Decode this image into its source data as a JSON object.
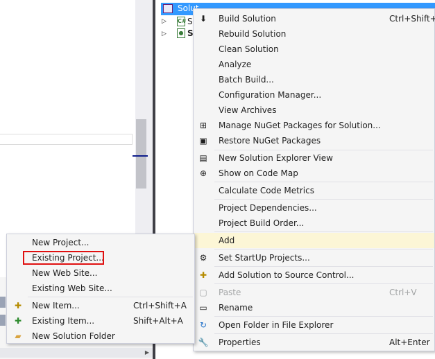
{
  "solution_explorer": {
    "solution_label": "Solution 'SolarCheck'",
    "project_1_icon": "C#",
    "project_1_label": "S",
    "project_2_label": "S"
  },
  "context_menu": {
    "items": [
      {
        "label": "Build Solution",
        "shortcut": "Ctrl+Shift+B",
        "icon": "build-icon"
      },
      {
        "label": "Rebuild Solution",
        "shortcut": "",
        "icon": ""
      },
      {
        "label": "Clean Solution",
        "shortcut": "",
        "icon": ""
      },
      {
        "label": "Analyze",
        "shortcut": "",
        "icon": ""
      },
      {
        "label": "Batch Build...",
        "shortcut": "",
        "icon": ""
      },
      {
        "label": "Configuration Manager...",
        "shortcut": "",
        "icon": ""
      },
      {
        "label": "View Archives",
        "shortcut": "",
        "icon": ""
      },
      {
        "label": "Manage NuGet Packages for Solution...",
        "shortcut": "",
        "icon": "nuget-icon"
      },
      {
        "label": "Restore NuGet Packages",
        "shortcut": "",
        "icon": "restore-icon"
      },
      {
        "label": "New Solution Explorer View",
        "shortcut": "",
        "icon": "new-view-icon"
      },
      {
        "label": "Show on Code Map",
        "shortcut": "",
        "icon": "code-map-icon"
      },
      {
        "label": "Calculate Code Metrics",
        "shortcut": "",
        "icon": ""
      },
      {
        "label": "Project Dependencies...",
        "shortcut": "",
        "icon": ""
      },
      {
        "label": "Project Build Order...",
        "shortcut": "",
        "icon": ""
      },
      {
        "label": "Add",
        "shortcut": "",
        "icon": ""
      },
      {
        "label": "Set StartUp Projects...",
        "shortcut": "",
        "icon": "gear-icon"
      },
      {
        "label": "Add Solution to Source Control...",
        "shortcut": "",
        "icon": "source-control-icon"
      },
      {
        "label": "Paste",
        "shortcut": "Ctrl+V",
        "icon": "paste-icon"
      },
      {
        "label": "Rename",
        "shortcut": "",
        "icon": "rename-icon"
      },
      {
        "label": "Open Folder in File Explorer",
        "shortcut": "",
        "icon": "refresh-arrow-icon"
      },
      {
        "label": "Properties",
        "shortcut": "Alt+Enter",
        "icon": "wrench-icon"
      }
    ]
  },
  "add_submenu": {
    "items": [
      {
        "label": "New Project...",
        "shortcut": "",
        "icon": ""
      },
      {
        "label": "Existing Project...",
        "shortcut": "",
        "icon": ""
      },
      {
        "label": "New Web Site...",
        "shortcut": "",
        "icon": ""
      },
      {
        "label": "Existing Web Site...",
        "shortcut": "",
        "icon": ""
      },
      {
        "label": "New Item...",
        "shortcut": "Ctrl+Shift+A",
        "icon": "new-item-icon"
      },
      {
        "label": "Existing Item...",
        "shortcut": "Shift+Alt+A",
        "icon": "existing-item-icon"
      },
      {
        "label": "New Solution Folder",
        "shortcut": "",
        "icon": "folder-icon"
      }
    ]
  },
  "colors": {
    "selection_blue": "#3399ff",
    "menu_bg": "#f5f5f5",
    "hover_highlight": "#fcf6d6",
    "callout_red": "#e01010",
    "disabled_text": "#a2a4a5"
  }
}
